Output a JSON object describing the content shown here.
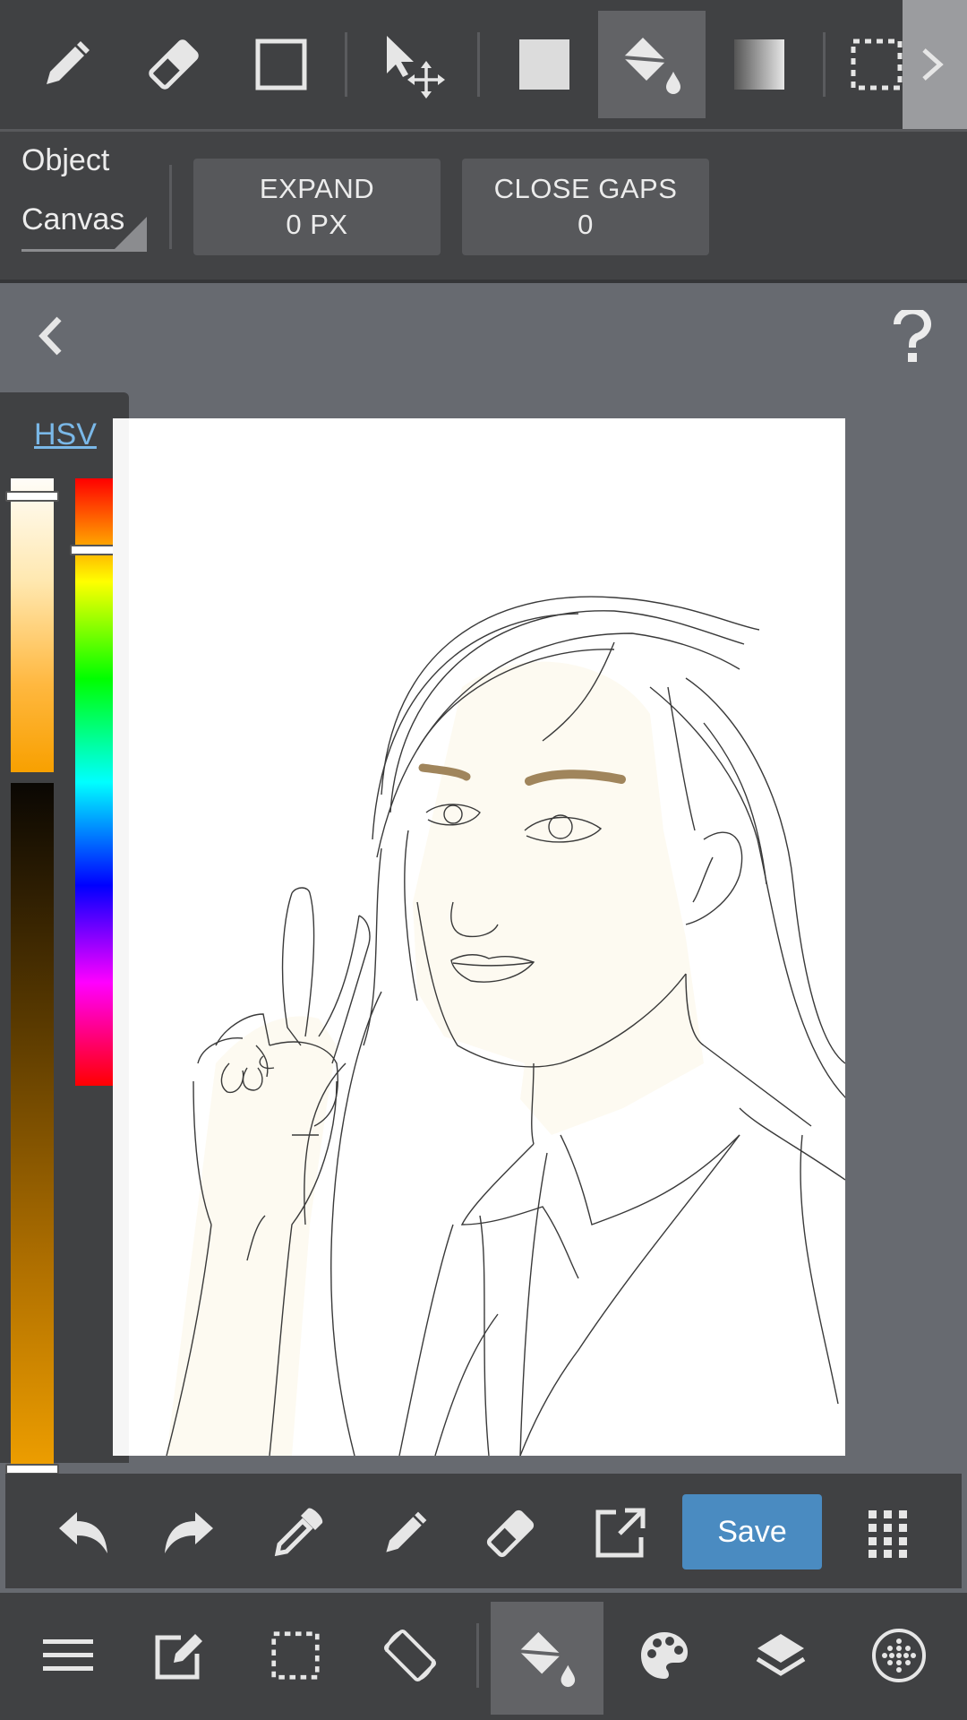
{
  "toolbar": {
    "tools": [
      "pen",
      "eraser",
      "rectangle",
      "move",
      "fill-shape",
      "bucket",
      "gradient",
      "selection"
    ],
    "active_tool": "bucket"
  },
  "options": {
    "fill_target_label": "Object",
    "fill_target_value": "Canvas",
    "expand_label": "EXPAND",
    "expand_value": "0 PX",
    "close_gaps_label": "CLOSE GAPS",
    "close_gaps_value": "0"
  },
  "color_panel": {
    "mode_label": "HSV",
    "value_level": 0.97,
    "saturation_level": 0.03,
    "hue_level": 0.12,
    "current_color": "#f0a000"
  },
  "quick_bar": {
    "save_label": "Save"
  },
  "main_bar": {
    "active_tool": "bucket"
  },
  "colors": {
    "accent": "#4a8bc1",
    "skin_fill": "#fdfaf1",
    "eyebrow": "#a0855c"
  }
}
